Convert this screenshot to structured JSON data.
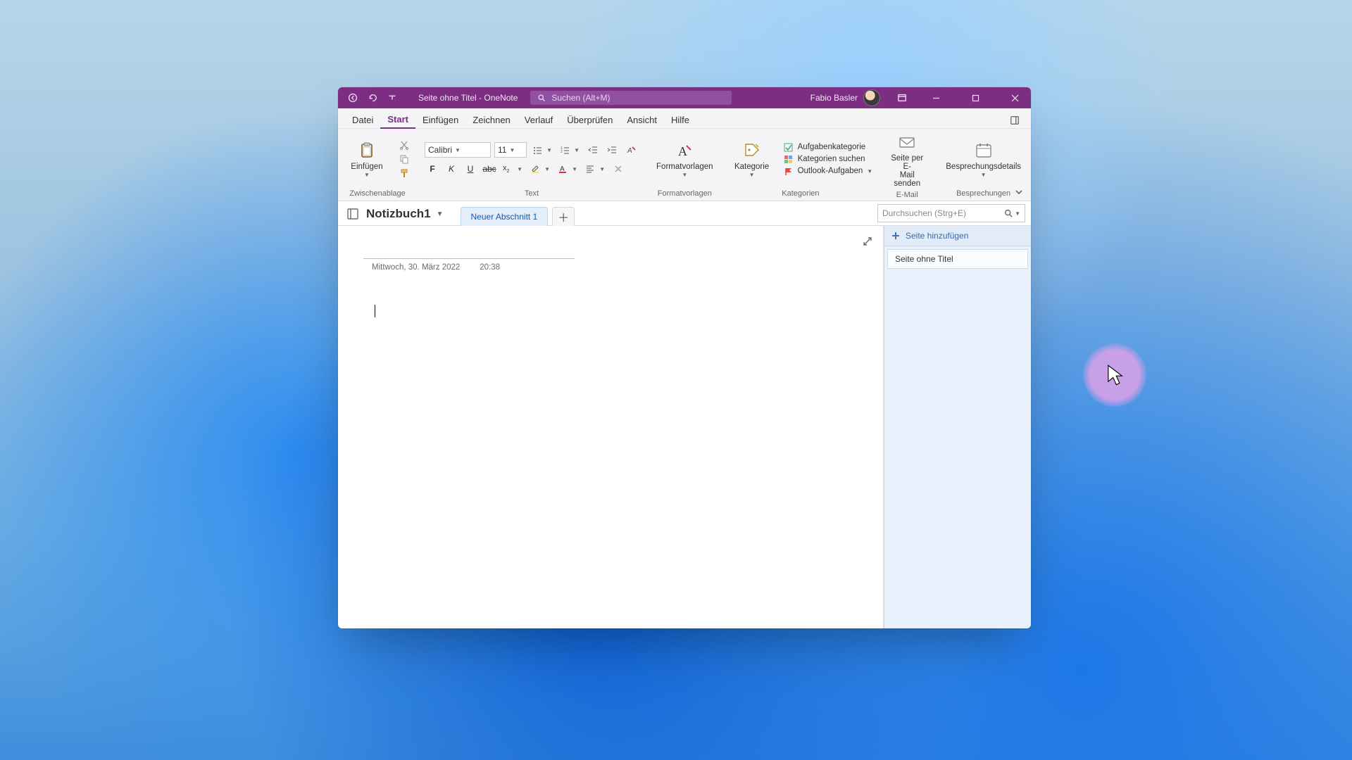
{
  "titlebar": {
    "title": "Seite ohne Titel  -  OneNote",
    "search_placeholder": "Suchen (Alt+M)",
    "user": "Fabio Basler"
  },
  "tabs": {
    "datei": "Datei",
    "start": "Start",
    "einfugen": "Einfügen",
    "zeichnen": "Zeichnen",
    "verlauf": "Verlauf",
    "uberprufen": "Überprüfen",
    "ansicht": "Ansicht",
    "hilfe": "Hilfe"
  },
  "ribbon": {
    "clipboard_label": "Zwischenablage",
    "paste": "Einfügen",
    "text_label": "Text",
    "font_name": "Calibri",
    "font_size": "11",
    "styles_label": "Formatvorlagen",
    "styles_btn": "Formatvorlagen",
    "tags_label": "Kategorien",
    "tags_btn": "Kategorie",
    "tag_action_task": "Aufgabenkategorie",
    "tag_action_find": "Kategorien suchen",
    "tag_action_outlook": "Outlook-Aufgaben",
    "email_label": "E-Mail",
    "email_btn_l1": "Seite per E-",
    "email_btn_l2": "Mail senden",
    "meet_label": "Besprechungen",
    "meet_btn": "Besprechungsdetails"
  },
  "notebook": {
    "name": "Notizbuch1",
    "section": "Neuer Abschnitt 1",
    "search_placeholder": "Durchsuchen (Strg+E)"
  },
  "page": {
    "date": "Mittwoch, 30. März 2022",
    "time": "20:38"
  },
  "pages_pane": {
    "add": "Seite hinzufügen",
    "item0": "Seite ohne Titel"
  }
}
